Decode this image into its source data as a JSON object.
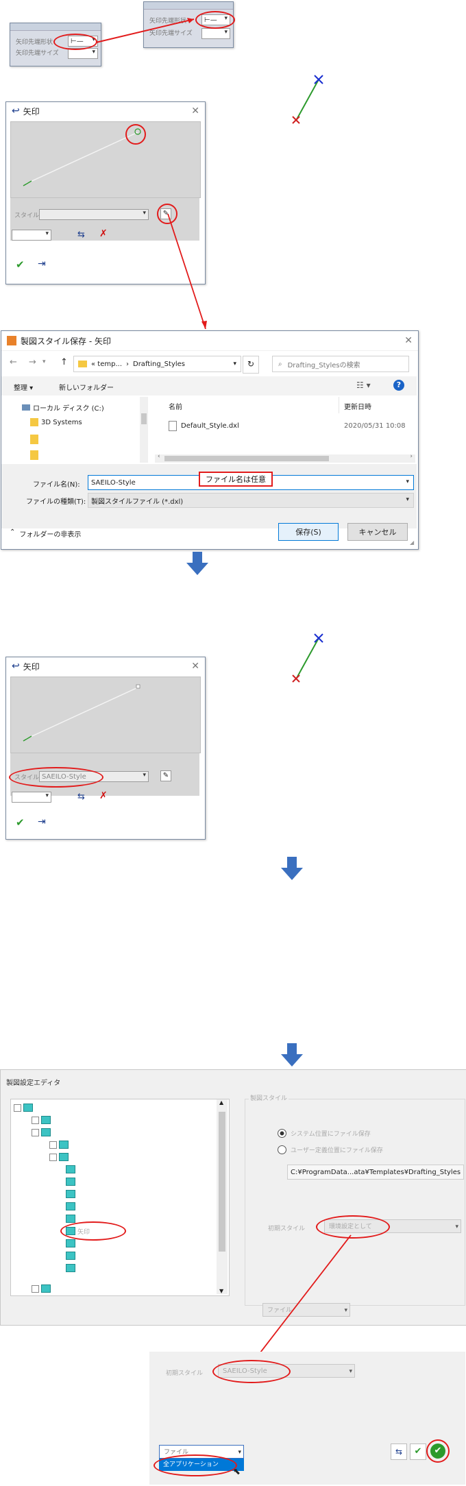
{
  "mini_panel_1": {
    "row1_label": "矢印先端形状",
    "row2_label": "矢印先端サイズ",
    "shape_value": "⊢—"
  },
  "mini_panel_2": {
    "row1_label": "矢印先端形状",
    "row2_label": "矢印先端サイズ",
    "shape_value": "⊢—"
  },
  "arrow_dialog_1": {
    "title": "矢印",
    "style_label": "スタイル",
    "style_value": ""
  },
  "save_dialog": {
    "title": "製図スタイル保存 - 矢印",
    "breadcrumb": [
      "« temp...",
      "Drafting_Styles"
    ],
    "search_placeholder": "Drafting_Stylesの検索",
    "toolbar_organize": "整理 ▾",
    "toolbar_new_folder": "新しいフォルダー",
    "tree": [
      "ローカル ディスク (C:)",
      "3D Systems",
      "",
      ""
    ],
    "col_name": "名前",
    "col_date": "更新日時",
    "files": [
      {
        "name": "Default_Style.dxl",
        "date": "2020/05/31 10:08"
      }
    ],
    "filename_label": "ファイル名(N):",
    "filename_value": "SAEILO-Style",
    "annotation": "ファイル名は任意",
    "filetype_label": "ファイルの種類(T):",
    "filetype_value": "製図スタイルファイル (*.dxl)",
    "hide_folders": "フォルダーの非表示",
    "save_button": "保存(S)",
    "cancel_button": "キャンセル"
  },
  "arrow_dialog_2": {
    "title": "矢印",
    "style_label": "スタイル",
    "style_value": "SAEILO-Style"
  },
  "settings_editor": {
    "title": "製図設定エディタ",
    "group_title": "製図スタイル",
    "radio_1": "システム位置にファイル保存",
    "radio_2": "ユーザー定義位置にファイル保存",
    "path_value": "C:¥ProgramData...ata¥Templates¥Drafting_Styles",
    "initial_style_label": "初期スタイル",
    "initial_style_value": "環境設定として",
    "highlight_item": "矢印",
    "bottom_select": "ファイル"
  },
  "settings_editor_2": {
    "initial_style_label": "初期スタイル",
    "initial_style_value": "SAEILO-Style",
    "bottom_select": "ファイル",
    "bottom_option": "全アプリケーション"
  },
  "colors": {
    "annotation_red": "#e21b1b",
    "flow_arrow_blue": "#3a6fbf",
    "dialog_grey": "#d9d9d9",
    "primary_blue": "#0078d7"
  }
}
